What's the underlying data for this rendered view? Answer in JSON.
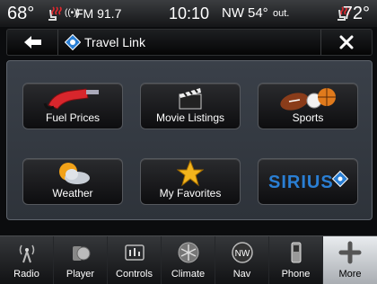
{
  "status_bar": {
    "temp_left": "68°",
    "radio_label": "FM 91.7",
    "clock": "10:10",
    "compass": "NW",
    "outside_temp": "54°",
    "outside_label": "out.",
    "temp_right": "72°"
  },
  "title_bar": {
    "title": "Travel Link"
  },
  "tiles": [
    {
      "label": "Fuel Prices",
      "icon": "fuel-nozzle-icon"
    },
    {
      "label": "Movie Listings",
      "icon": "clapperboard-icon"
    },
    {
      "label": "Sports",
      "icon": "sports-balls-icon"
    },
    {
      "label": "Weather",
      "icon": "sun-cloud-icon"
    },
    {
      "label": "My Favorites",
      "icon": "star-icon"
    },
    {
      "label": "SIRIUS",
      "icon": "sirius-logo"
    }
  ],
  "nav": [
    {
      "label": "Radio",
      "icon": "radio-tower-icon"
    },
    {
      "label": "Player",
      "icon": "player-icon"
    },
    {
      "label": "Controls",
      "icon": "controls-icon"
    },
    {
      "label": "Climate",
      "icon": "climate-icon"
    },
    {
      "label": "Nav",
      "icon": "compass-nw-icon"
    },
    {
      "label": "Phone",
      "icon": "phone-icon"
    },
    {
      "label": "More",
      "icon": "plus-icon"
    }
  ],
  "nav_active": "More",
  "colors": {
    "accent_red": "#d8262c",
    "sirius_blue": "#2a7fd4",
    "star_gold": "#f3b41c"
  }
}
